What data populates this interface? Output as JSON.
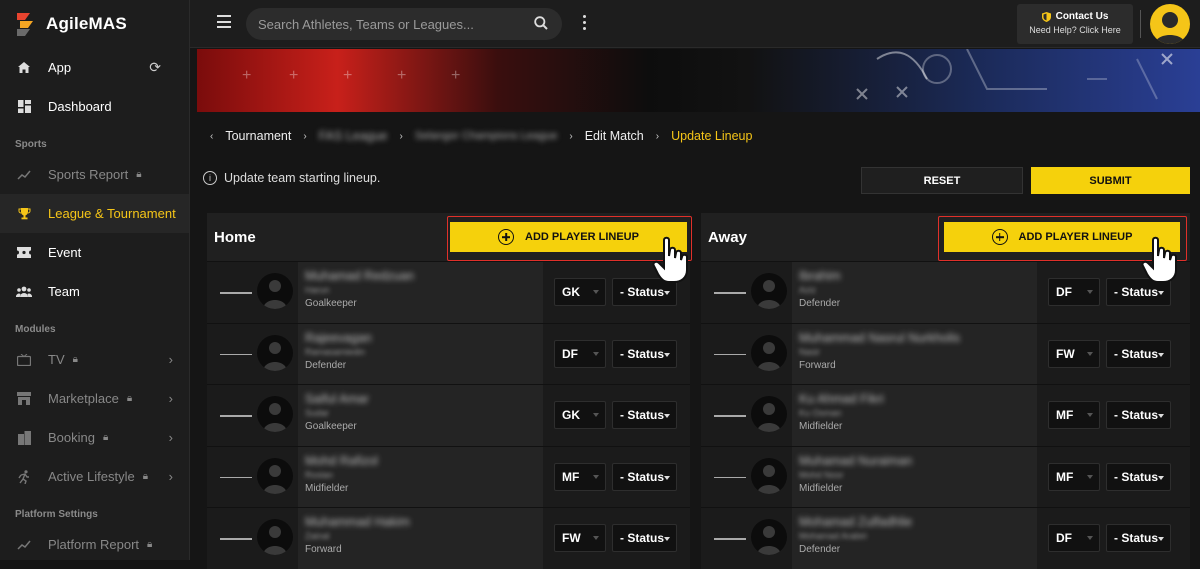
{
  "app": {
    "name": "AgileMAS"
  },
  "sidebar": {
    "items": [
      {
        "label": "App",
        "icon": "home-icon"
      },
      {
        "label": "Dashboard",
        "icon": "dashboard-icon"
      }
    ],
    "sections": [
      {
        "label": "Sports"
      },
      {
        "label": "Modules"
      },
      {
        "label": "Platform Settings"
      }
    ],
    "sports": [
      {
        "label": "Sports Report",
        "locked": true
      },
      {
        "label": "League & Tournament",
        "active": true
      },
      {
        "label": "Event"
      },
      {
        "label": "Team"
      }
    ],
    "modules": [
      {
        "label": "TV",
        "locked": true
      },
      {
        "label": "Marketplace",
        "locked": true
      },
      {
        "label": "Booking",
        "locked": true
      },
      {
        "label": "Active Lifestyle",
        "locked": true
      }
    ],
    "platform": [
      {
        "label": "Platform Report",
        "locked": true
      }
    ]
  },
  "topbar": {
    "search_placeholder": "Search Athletes, Teams or Leagues...",
    "contact_title": "Contact Us",
    "contact_sub": "Need Help? Click Here"
  },
  "breadcrumb": [
    {
      "label": "Tournament"
    },
    {
      "label": "FAS League"
    },
    {
      "label": "Selangor Champions League"
    },
    {
      "label": "Edit Match"
    },
    {
      "label": "Update Lineup"
    }
  ],
  "info_text": "Update team starting lineup.",
  "actions": {
    "reset": "RESET",
    "submit": "SUBMIT"
  },
  "home": {
    "title": "Home",
    "add_label": "ADD PLAYER LINEUP",
    "players": [
      {
        "name": "Muhamad Redzuan",
        "sub": "Harun",
        "position": "Goalkeeper",
        "pos_code": "GK",
        "status": "- Status"
      },
      {
        "name": "Rajeevagan",
        "sub": "Ramasamiedin",
        "position": "Defender",
        "pos_code": "DF",
        "status": "- Status"
      },
      {
        "name": "Saiful Amar",
        "sub": "Sudar",
        "position": "Goalkeeper",
        "pos_code": "GK",
        "status": "- Status"
      },
      {
        "name": "Mohd Rafizol",
        "sub": "Roslan",
        "position": "Midfielder",
        "pos_code": "MF",
        "status": "- Status"
      },
      {
        "name": "Muhammad Hakim",
        "sub": "Zainal",
        "position": "Forward",
        "pos_code": "FW",
        "status": "- Status"
      }
    ]
  },
  "away": {
    "title": "Away",
    "add_label": "ADD PLAYER LINEUP",
    "players": [
      {
        "name": "Ibrahim",
        "sub": "Aziz",
        "position": "Defender",
        "pos_code": "DF",
        "status": "- Status"
      },
      {
        "name": "Muhammad Nasrul Nurkholis",
        "sub": "Nasir",
        "position": "Forward",
        "pos_code": "FW",
        "status": "- Status"
      },
      {
        "name": "Ku Ahmad Fikri",
        "sub": "Ku Osman",
        "position": "Midfielder",
        "pos_code": "MF",
        "status": "- Status"
      },
      {
        "name": "Muhamad Nuraiman",
        "sub": "Mohd Noor",
        "position": "Midfielder",
        "pos_code": "MF",
        "status": "- Status"
      },
      {
        "name": "Mohamad Zulfadhlie",
        "sub": "Mohamad Arabiri",
        "position": "Defender",
        "pos_code": "DF",
        "status": "- Status"
      }
    ]
  },
  "colors": {
    "accent": "#f5d10c",
    "active_text": "#f5c518",
    "highlight": "#e0302a"
  }
}
